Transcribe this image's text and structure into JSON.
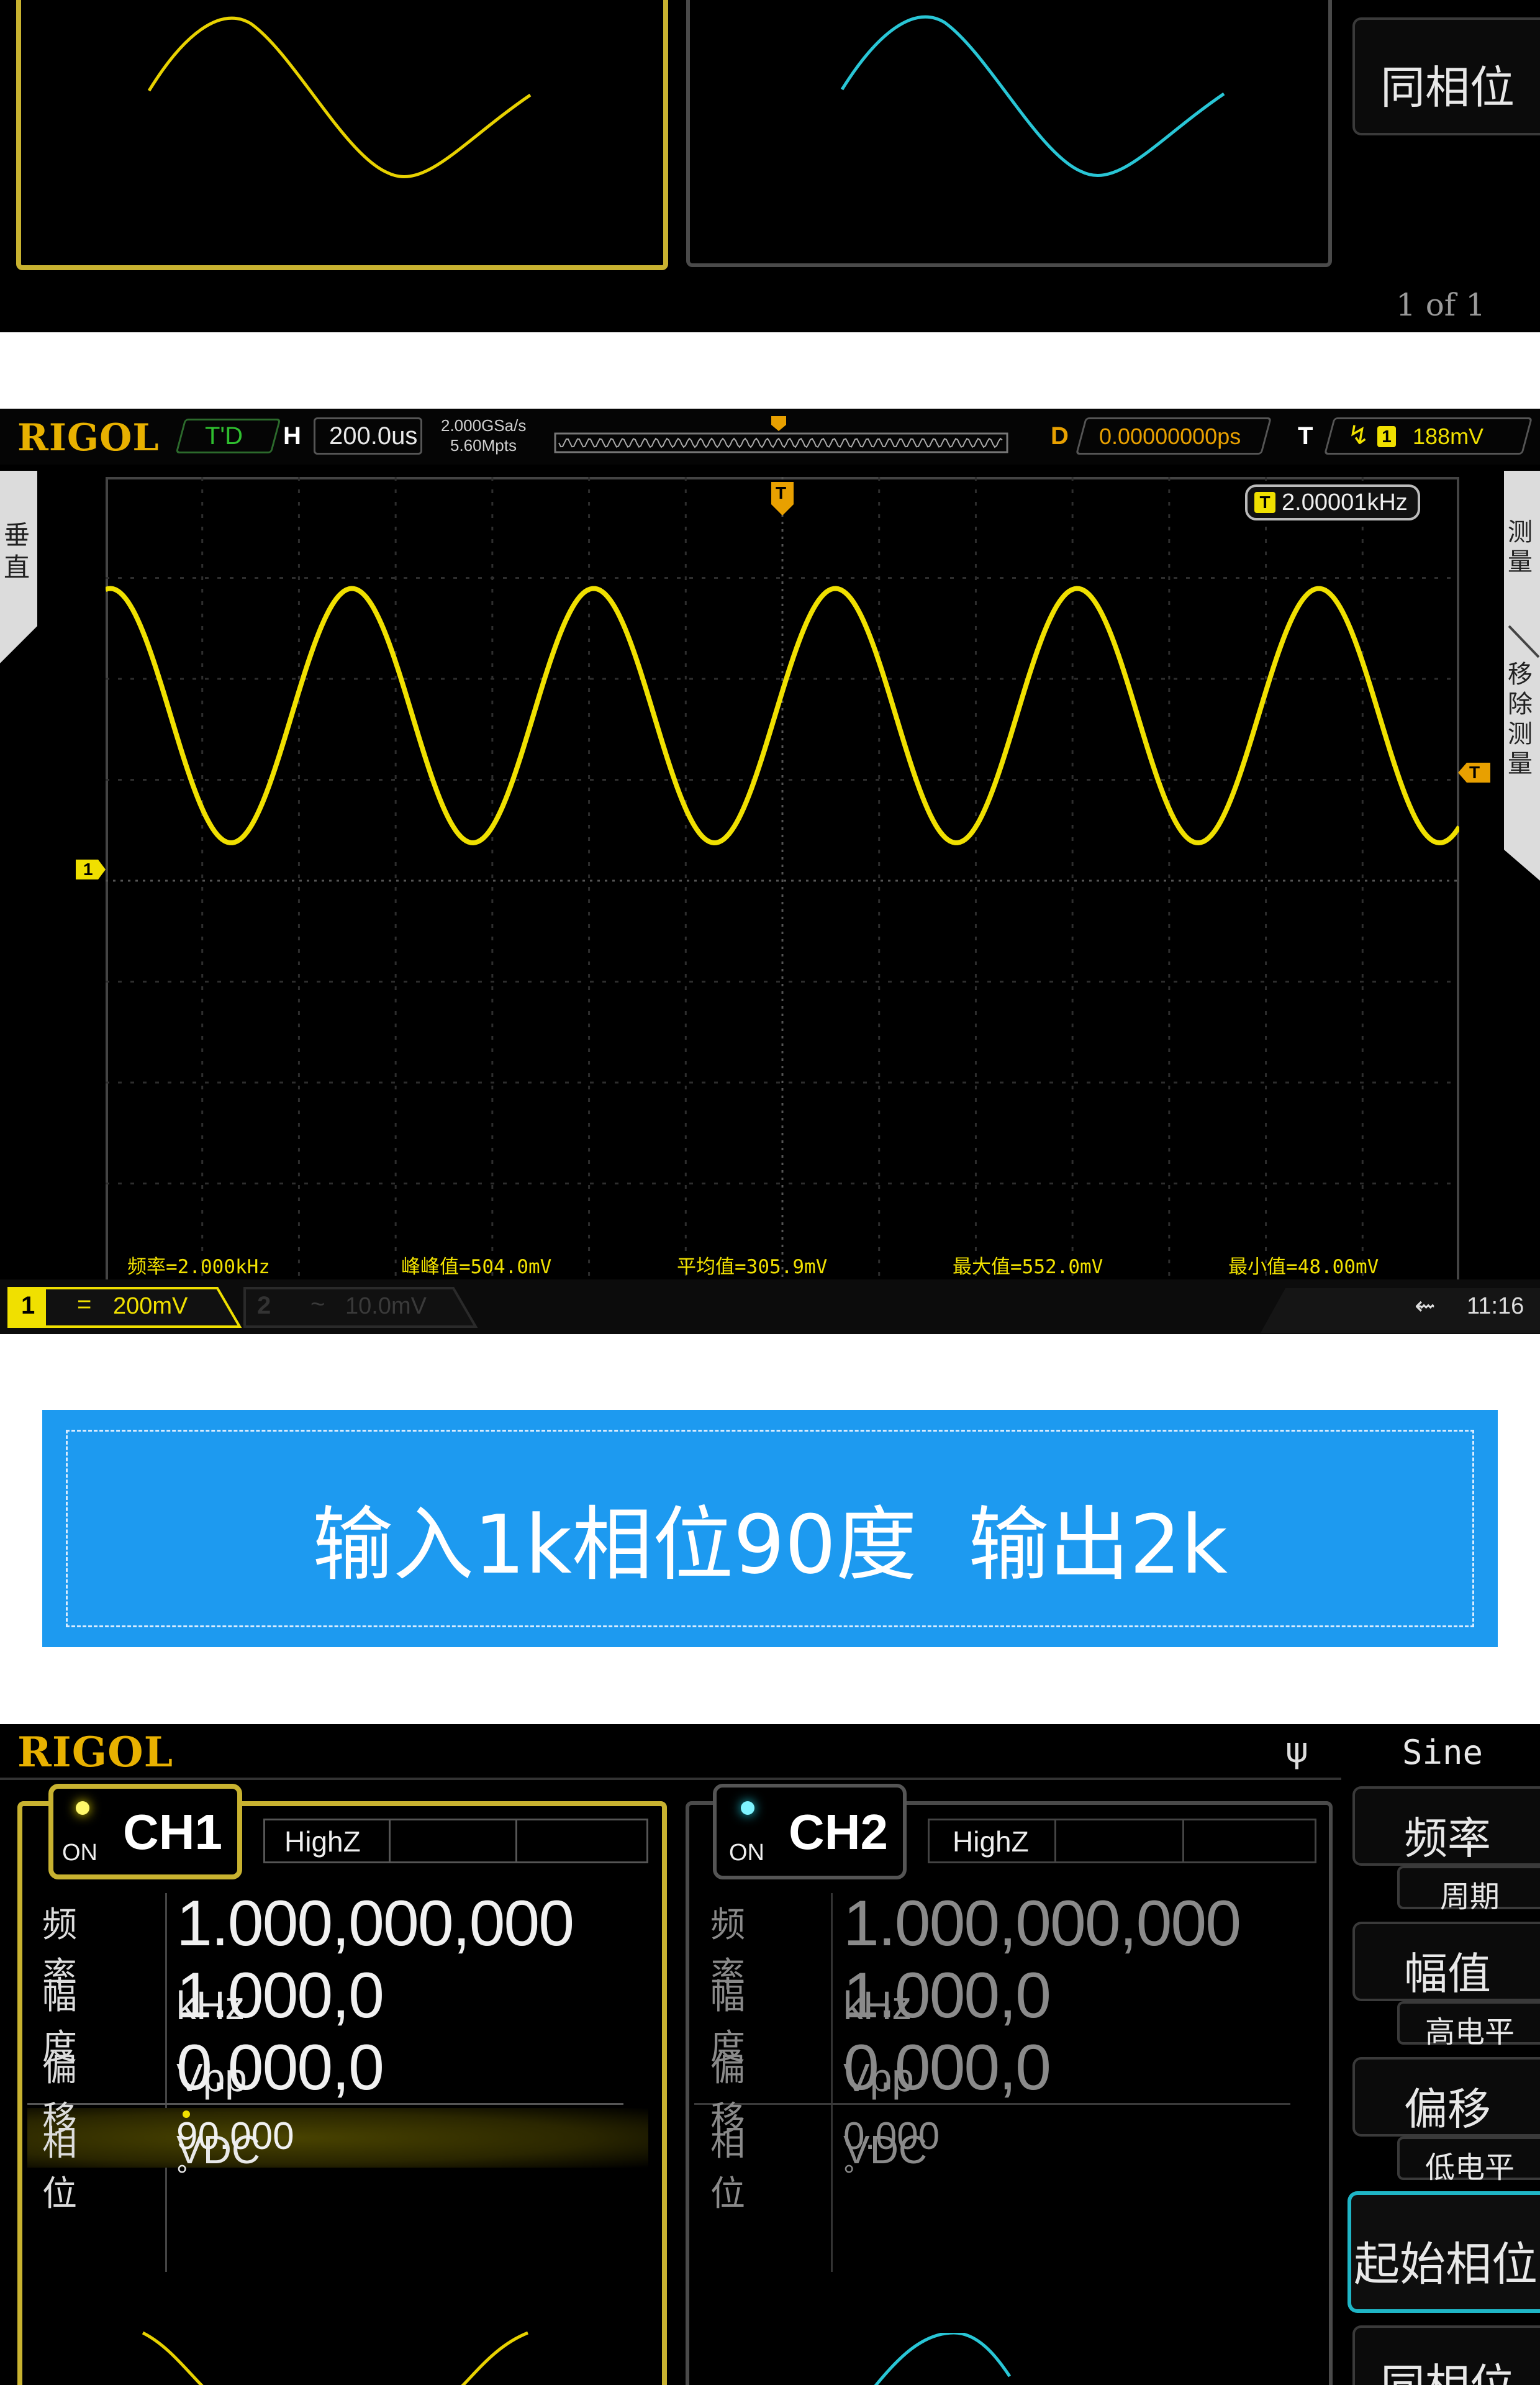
{
  "section1": {
    "softkey_same_phase": "同相位",
    "page_indicator": "1 of 1"
  },
  "scope": {
    "brand": "RIGOL",
    "mode": "T'D",
    "h_label": "H",
    "timebase": "200.0us",
    "sample_rate": "2.000GSa/s",
    "memory_depth": "5.60Mpts",
    "delay_label": "D",
    "delay_value": "0.00000000ps",
    "trigger_label": "T",
    "trigger_level": "188mV",
    "trigger_channel": "1",
    "freq_readout_badge": "T",
    "freq_readout": "2.00001kHz",
    "left_tab": "垂直",
    "right_tab_measure": "测量",
    "right_tab_remove": "移除测量",
    "ch1_marker": "1",
    "trig_marker": "T",
    "measurements": [
      "频率=2.000kHz",
      "峰峰值=504.0mV",
      "平均值=305.9mV",
      "最大值=552.0mV",
      "最小值=48.00mV"
    ],
    "ch1_num": "1",
    "ch1_coupling": "=",
    "ch1_scale": "200mV",
    "ch2_num": "2",
    "ch2_coupling": "~",
    "ch2_scale": "10.0mV",
    "usb_icon": "usb-icon",
    "time": "11:16",
    "waveform": {
      "cycles_visible": 5.6,
      "trace_color": "#f0e000",
      "frequency": "2.000kHz",
      "vpp_mV": 504.0,
      "max_mV": 552.0,
      "min_mV": 48.0
    }
  },
  "banner": {
    "text": "输入1k相位90度  输出2k",
    "color": "#1d9af0"
  },
  "generator": {
    "brand": "RIGOL",
    "usb_icon": "usb-icon",
    "waveform_type": "Sine",
    "ch1": {
      "on_label": "ON",
      "name": "CH1",
      "load": "HighZ",
      "rows": [
        {
          "label": "频率",
          "value": "1.000,000,000",
          "unit": "kHz"
        },
        {
          "label": "幅度",
          "value": "1.000,0",
          "unit": "Vpp"
        },
        {
          "label": "偏移",
          "value": "0.000,0",
          "unit": "VDC"
        },
        {
          "label": "相位",
          "value": "90.000",
          "unit": "°"
        }
      ]
    },
    "ch2": {
      "on_label": "ON",
      "name": "CH2",
      "load": "HighZ",
      "rows": [
        {
          "label": "频率",
          "value": "1.000,000,000",
          "unit": "kHz"
        },
        {
          "label": "幅度",
          "value": "1.000,0",
          "unit": "Vpp"
        },
        {
          "label": "偏移",
          "value": "0.000,0",
          "unit": "VDC"
        },
        {
          "label": "相位",
          "value": "0.000",
          "unit": "°"
        }
      ]
    },
    "softkeys": {
      "freq": "频率",
      "period": "周期",
      "amplitude": "幅值",
      "high_level": "高电平",
      "offset": "偏移",
      "low_level": "低电平",
      "start_phase": "起始相位",
      "same_phase": "同相位"
    },
    "colors": {
      "ch1": "#f2dc00",
      "ch2": "#1fd0e0"
    }
  }
}
